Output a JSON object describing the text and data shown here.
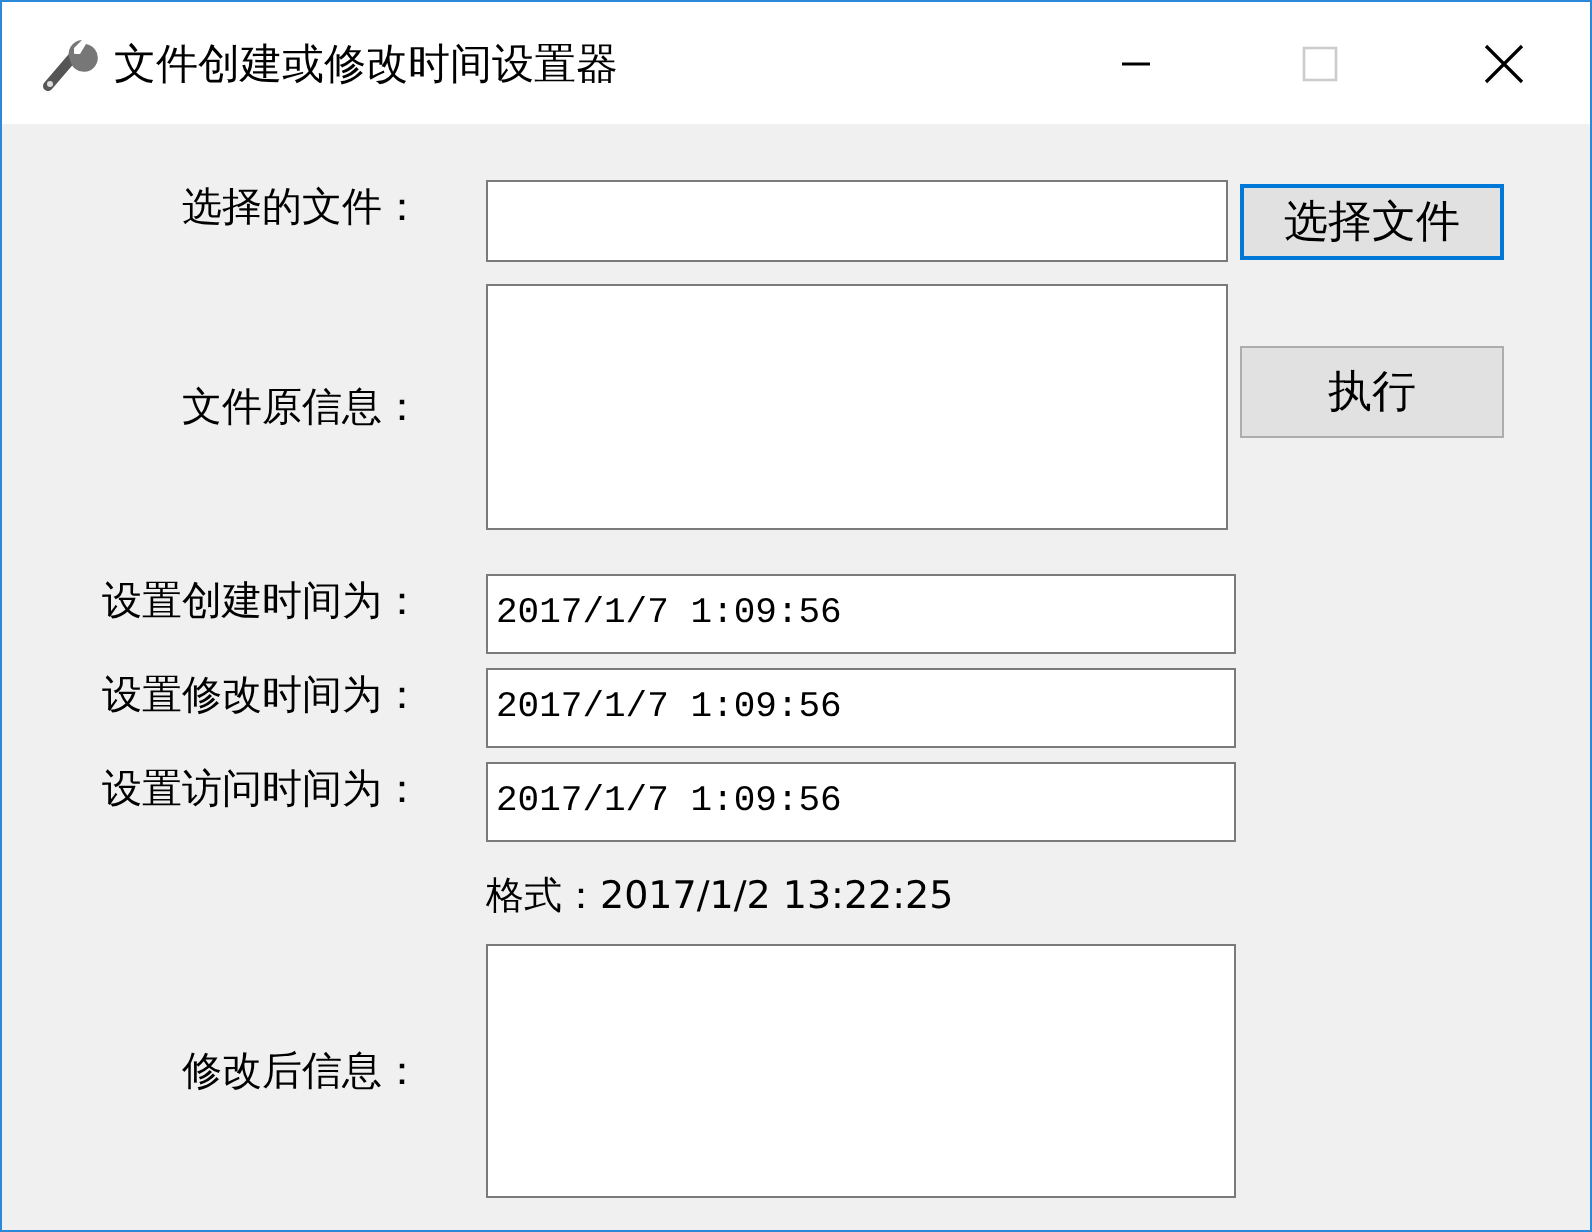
{
  "window": {
    "title": "文件创建或修改时间设置器"
  },
  "rows": [
    {
      "kind": "file",
      "label": "选择的文件：",
      "button": {
        "label": "选择文件",
        "focused": true
      }
    },
    {
      "kind": "info",
      "label": "文件原信息：",
      "button": {
        "label": "执行",
        "focused": false
      }
    },
    {
      "kind": "time",
      "label": "设置创建时间为：",
      "value": "2017/1/7 1:09:56"
    },
    {
      "kind": "time",
      "label": "设置修改时间为：",
      "value": "2017/1/7 1:09:56"
    },
    {
      "kind": "time",
      "label": "设置访问时间为：",
      "value": "2017/1/7 1:09:56"
    },
    {
      "kind": "hint",
      "text": "格式：2017/1/2 13:22:25"
    },
    {
      "kind": "result",
      "label": "修改后信息："
    }
  ]
}
